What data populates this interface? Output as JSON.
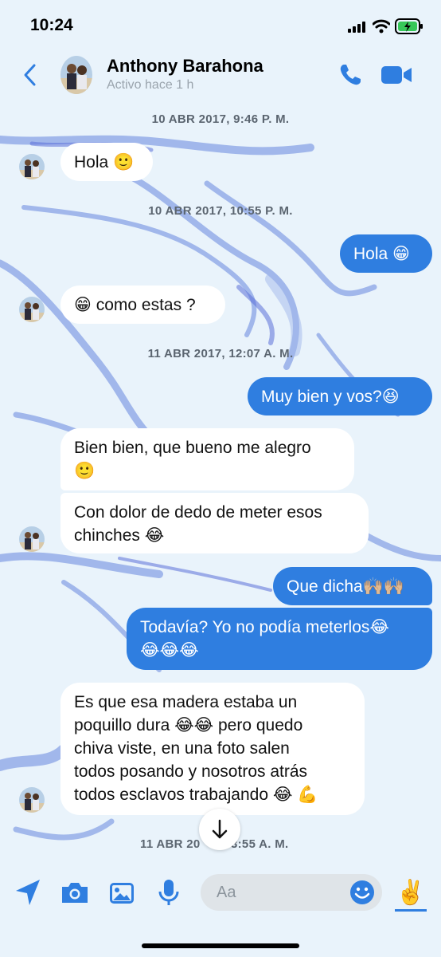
{
  "status_bar": {
    "time": "10:24"
  },
  "header": {
    "contact_name": "Anthony Barahona",
    "contact_status": "Activo hace 1 h"
  },
  "messages": [
    {
      "kind": "timestamp",
      "text": "10 ABR 2017, 9:46 P. M."
    },
    {
      "kind": "incoming",
      "lines": [
        "Hola 🙂"
      ]
    },
    {
      "kind": "timestamp",
      "text": "10 ABR 2017, 10:55 P. M."
    },
    {
      "kind": "outgoing",
      "lines": [
        "Hola 😁"
      ]
    },
    {
      "kind": "incoming",
      "lines": [
        "😁 como estas ?"
      ]
    },
    {
      "kind": "timestamp",
      "text": "11 ABR 2017, 12:07 A. M."
    },
    {
      "kind": "outgoing",
      "lines": [
        "Muy bien y vos?😆"
      ]
    },
    {
      "kind": "incoming",
      "lines": [
        "Bien bien, que bueno me alegro",
        "🙂"
      ]
    },
    {
      "kind": "incoming",
      "lines": [
        "Con dolor de dedo de meter esos",
        "chinches 😂"
      ]
    },
    {
      "kind": "outgoing",
      "lines": [
        "Que dicha🙌🏼🙌🏼"
      ]
    },
    {
      "kind": "outgoing",
      "lines": [
        "Todavía? Yo no podía meterlos😂",
        "😂😂😂"
      ]
    },
    {
      "kind": "incoming",
      "lines": [
        "Es que esa madera estaba un",
        "poquillo dura 😂😂 pero quedo",
        "chiva viste, en una foto salen",
        "todos posando y nosotros atrás",
        "todos esclavos trabajando 😂 💪"
      ]
    },
    {
      "kind": "timestamp",
      "text": "11 ABR 20🡓3:55 A. M."
    }
  ],
  "last_timestamp": {
    "left": "11 ABR 20",
    "right": "3:55 A. M."
  },
  "composer": {
    "placeholder": "Aa",
    "quick_reaction": "✌️"
  },
  "colors": {
    "accent": "#2f7ee0",
    "incoming_bubble": "#ffffff",
    "background": "#e9f3fb"
  },
  "icons": [
    "back-icon",
    "phone-icon",
    "video-icon",
    "location-arrow-icon",
    "camera-icon",
    "gallery-icon",
    "microphone-icon",
    "emoji-icon",
    "arrow-down-icon"
  ]
}
